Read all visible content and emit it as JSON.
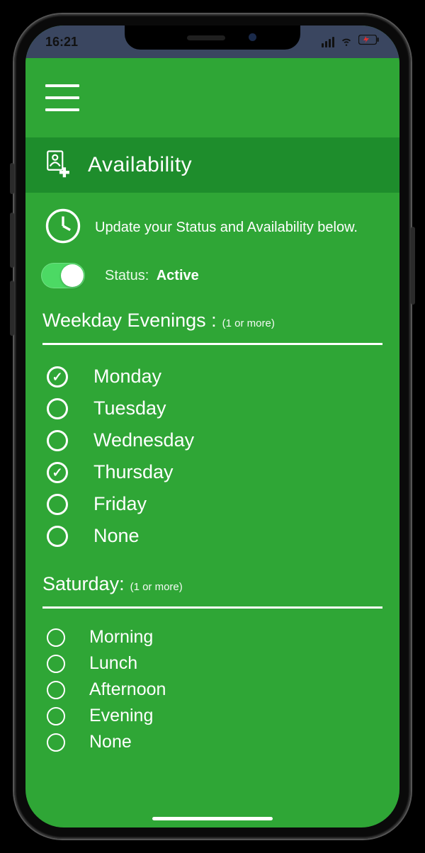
{
  "statusBar": {
    "time": "16:21"
  },
  "header": {
    "title": "Availability"
  },
  "hint": "Update your Status and Availability below.",
  "status": {
    "label": "Status:",
    "value": "Active",
    "active": true
  },
  "sections": {
    "weekday": {
      "title": "Weekday Evenings :",
      "note": "(1 or more)",
      "options": [
        {
          "label": "Monday",
          "checked": true
        },
        {
          "label": "Tuesday",
          "checked": false
        },
        {
          "label": "Wednesday",
          "checked": false
        },
        {
          "label": "Thursday",
          "checked": true
        },
        {
          "label": "Friday",
          "checked": false
        },
        {
          "label": "None",
          "checked": false
        }
      ]
    },
    "saturday": {
      "title": "Saturday:",
      "note": "(1 or more)",
      "options": [
        {
          "label": "Morning",
          "checked": false
        },
        {
          "label": "Lunch",
          "checked": false
        },
        {
          "label": "Afternoon",
          "checked": false
        },
        {
          "label": "Evening",
          "checked": false
        },
        {
          "label": "None",
          "checked": false
        }
      ]
    }
  }
}
